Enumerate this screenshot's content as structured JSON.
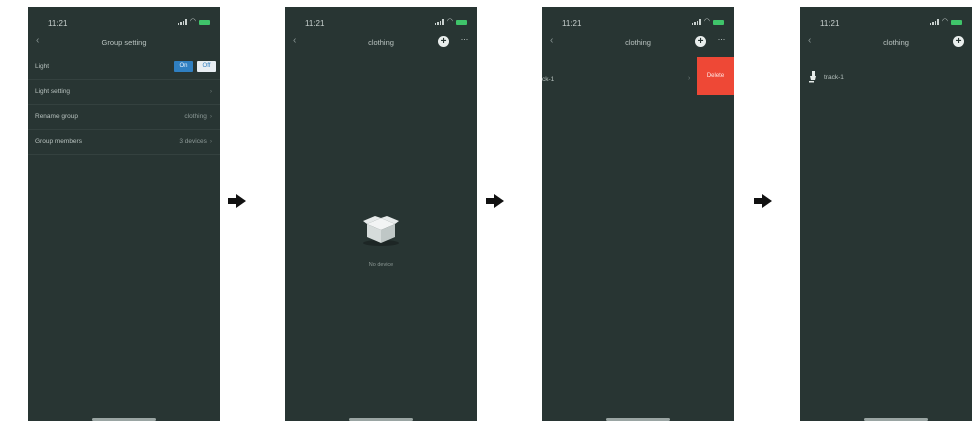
{
  "status": {
    "time": "11:21"
  },
  "panel1": {
    "nav_title": "Group setting",
    "rows": [
      {
        "label": "Light"
      },
      {
        "label": "Light setting",
        "value": ""
      },
      {
        "label": "Rename group",
        "value": "clothing"
      },
      {
        "label": "Group members",
        "value": "3 devices"
      }
    ],
    "toggle": {
      "on_label": "On",
      "off_label": "Off"
    }
  },
  "panel2": {
    "nav_title": "clothing",
    "empty_text": "No device"
  },
  "panel3": {
    "nav_title": "clothing",
    "row_name": "ck-1",
    "delete_label": "Delete"
  },
  "panel4": {
    "nav_title": "clothing",
    "device_name": "track-1"
  },
  "icons": {
    "back": "chevron-left-icon",
    "add": "plus-circle-icon",
    "more": "more-icon",
    "step": "arrow-right-icon",
    "device": "track-light-icon"
  },
  "colors": {
    "background": "#283533",
    "accent_blue": "#2f7fc1",
    "delete_red": "#ee4836",
    "battery_green": "#3fc46a"
  }
}
